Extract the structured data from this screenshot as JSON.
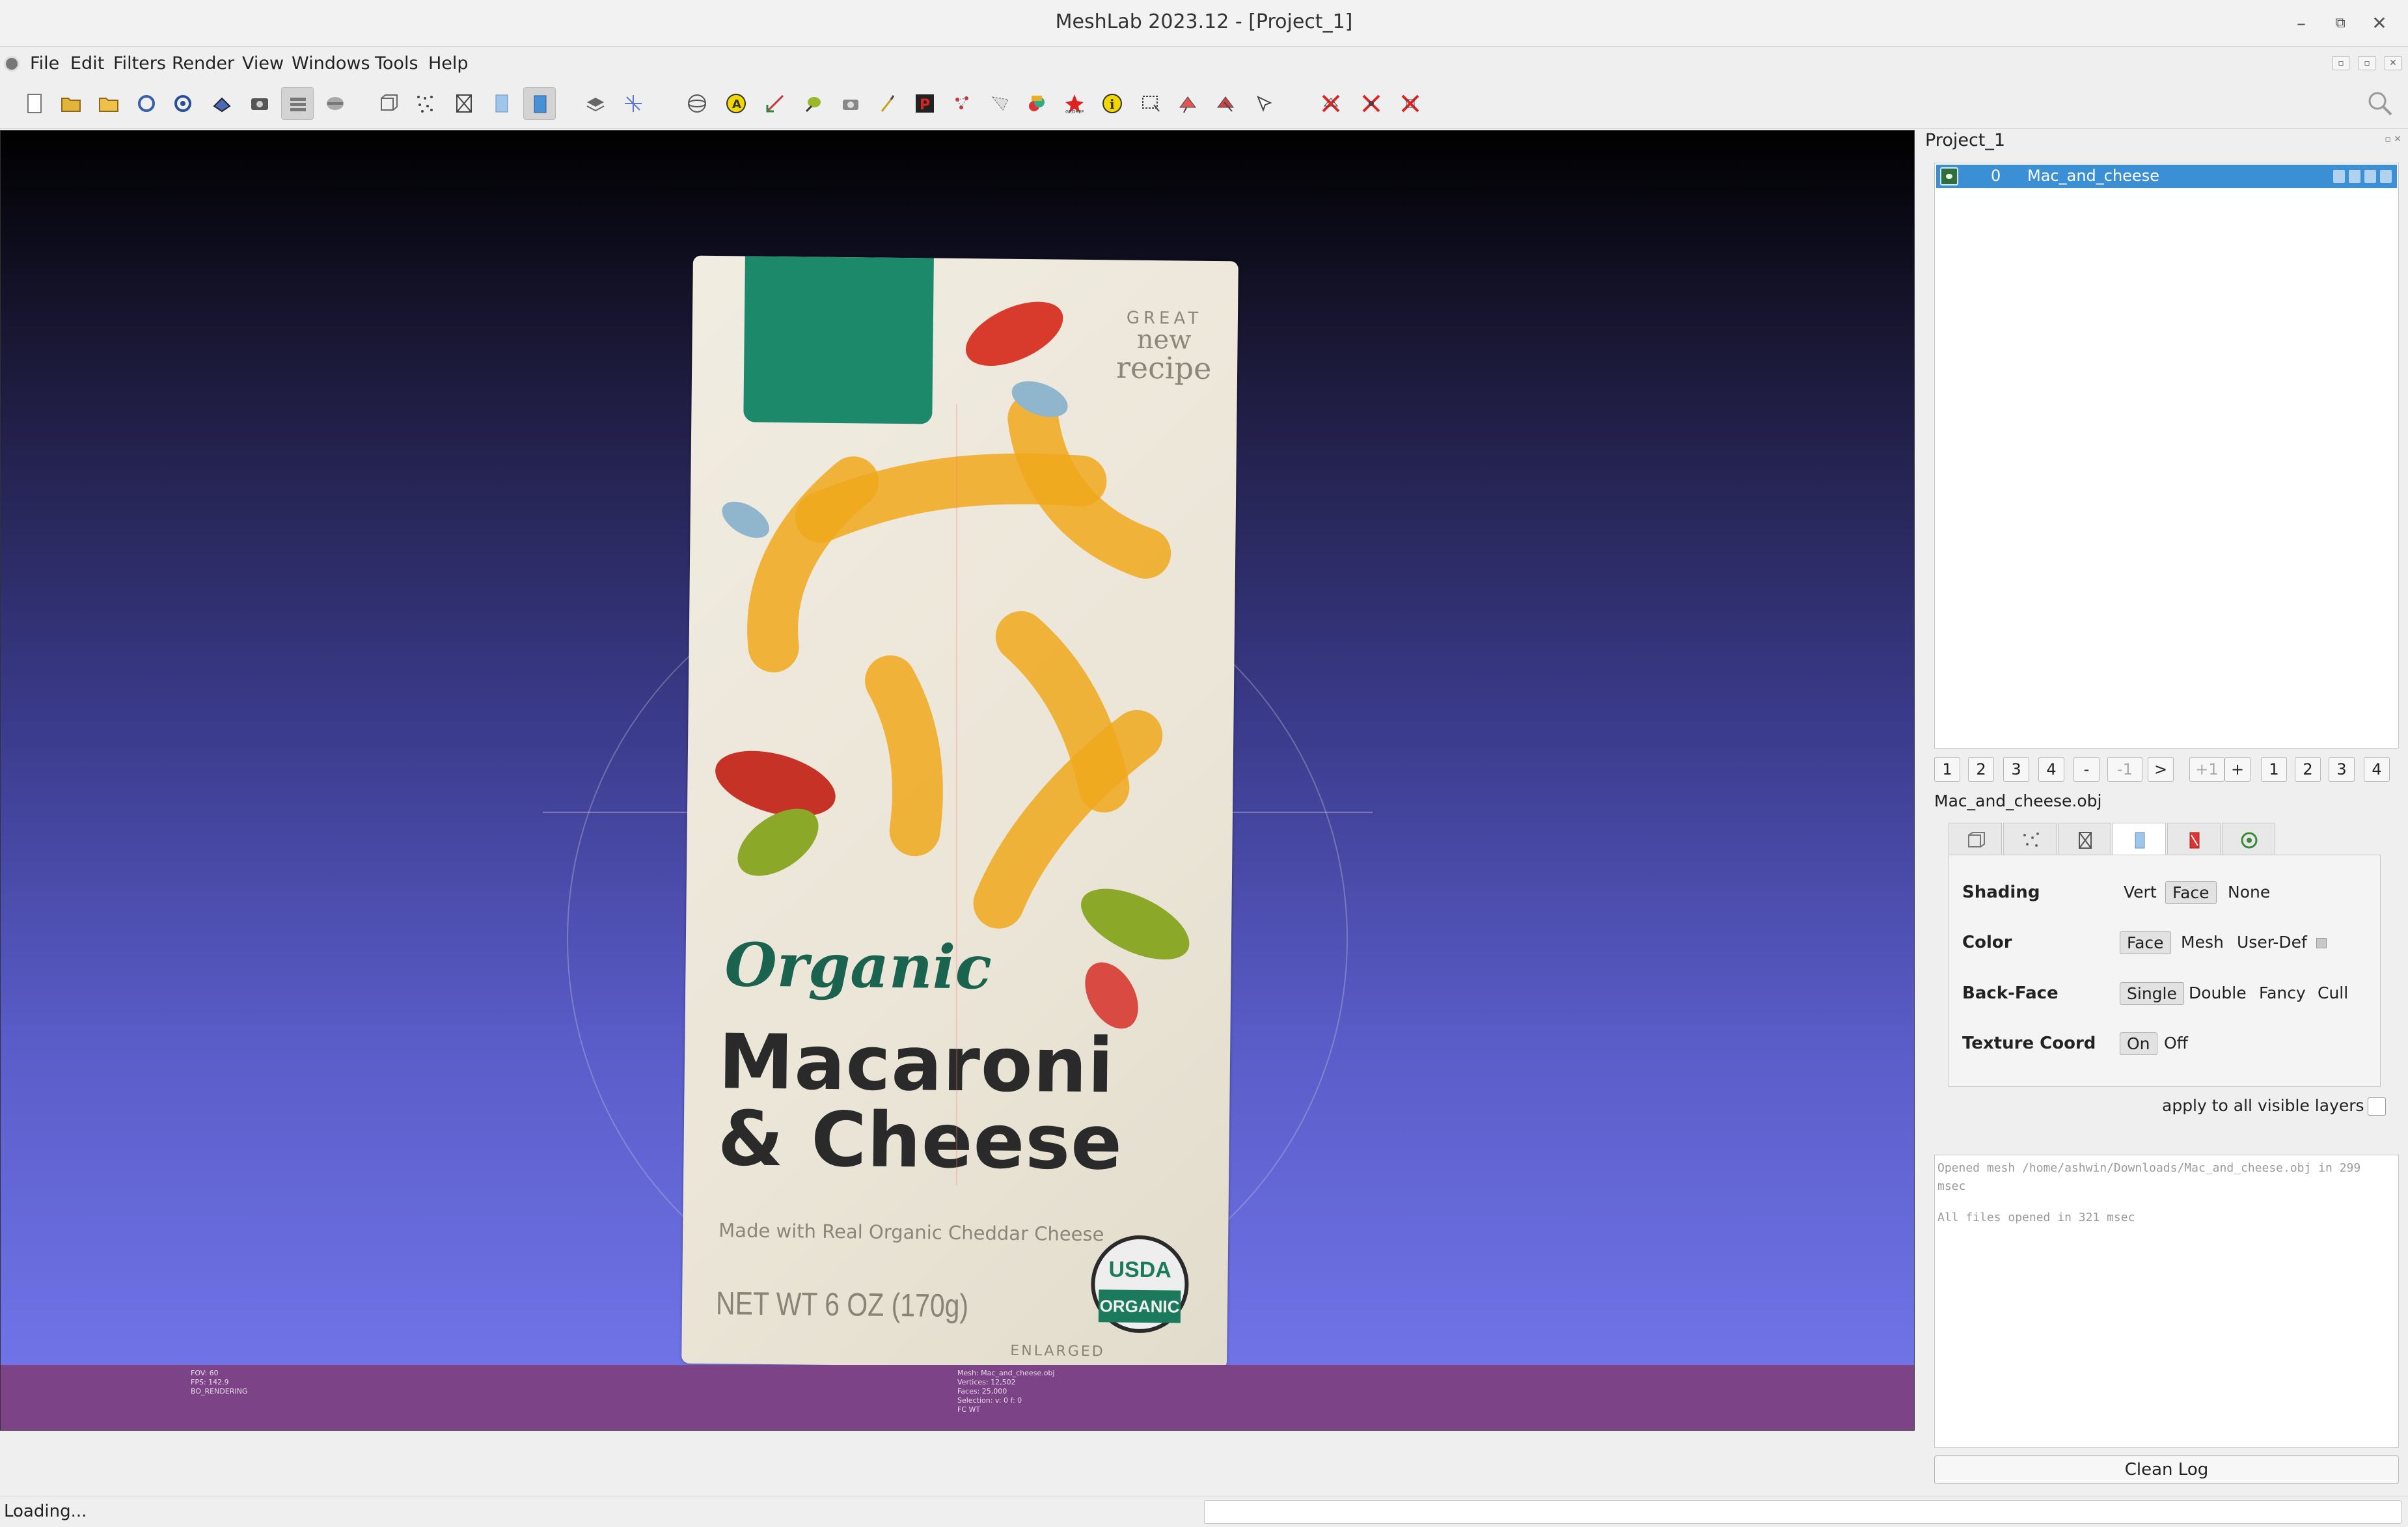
{
  "window": {
    "title": "MeshLab 2023.12 - [Project_1]",
    "minimize_glyph": "–",
    "restore_glyph": "⧉",
    "close_glyph": "✕"
  },
  "menu": {
    "items": [
      "File",
      "Edit",
      "Filters",
      "Render",
      "View",
      "Windows",
      "Tools",
      "Help"
    ]
  },
  "mdi_controls": [
    "▫",
    "▫",
    "✕"
  ],
  "toolbar": {
    "icons": [
      "new-project-icon",
      "open-project-icon",
      "import-mesh-icon",
      "reload-icon",
      "reload-all-icon",
      "export-mesh-icon",
      "snapshot-icon",
      "layers-icon",
      "raster-layers-icon",
      "bounding-box-icon",
      "points-icon",
      "wireframe-icon",
      "flat-icon",
      "smooth-icon",
      "light-icon",
      "axis-icon",
      "trackball-icon",
      "annotate-icon",
      "measure-icon",
      "pick-icon",
      "camera-icon",
      "paint-brush-icon",
      "pick-points-icon",
      "select-vertices-icon",
      "select-faces-icon",
      "align-icon",
      "georef-icon",
      "info-icon",
      "select-rect-icon",
      "select-connected-icon",
      "select-conn-faces-icon",
      "select-vertex-icon",
      "delete-face-icon",
      "delete-vertex-icon",
      "delete-selected-icon"
    ],
    "active": [
      "layers-icon",
      "smooth-icon"
    ]
  },
  "viewport": {
    "model": {
      "badge": "GREAT",
      "badge_line2": "new",
      "badge_line3": "recipe",
      "brand_script": "Organic",
      "product_line1": "Macaroni",
      "product_line2": "& Cheese",
      "subtitle": "Made with Real Organic Cheddar Cheese",
      "net_weight": "NET WT 6 OZ (170g)",
      "seal_top": "USDA",
      "seal_bottom": "ORGANIC",
      "footnote": "ENLARGED"
    },
    "info_left": [
      "FOV: 60",
      "FPS:   142.9",
      "BO_RENDERING"
    ],
    "info_mid": [
      "Mesh: Mac_and_cheese.obj",
      "Vertices: 12,502",
      "Faces: 25,000",
      "Selection: v: 0 f: 0",
      "FC WT"
    ]
  },
  "panel": {
    "title": "Project_1",
    "float_glyph": "▫ ✕",
    "layers": [
      {
        "index": "0",
        "name": "Mac_and_cheese"
      }
    ],
    "nav_buttons": [
      "1",
      "2",
      "3",
      "4",
      "-",
      "-1",
      ">",
      "+1",
      "+",
      "1",
      "2",
      "3",
      "4"
    ],
    "nav_disabled": [
      "-1",
      "+1"
    ],
    "mesh_file": "Mac_and_cheese.obj",
    "render_tabs": [
      "box-tab-icon",
      "points-tab-icon",
      "wire-tab-icon",
      "solid-tab-icon",
      "texture-tab-icon",
      "extra-tab-icon"
    ],
    "render_tab_active": "solid-tab-icon",
    "options": {
      "shading": {
        "label": "Shading",
        "values": [
          "Vert",
          "Face",
          "None"
        ],
        "selected": "Face"
      },
      "color": {
        "label": "Color",
        "values": [
          "Face",
          "Mesh",
          "User-Def"
        ],
        "selected": "Face"
      },
      "backface": {
        "label": "Back-Face",
        "values": [
          "Single",
          "Double",
          "Fancy",
          "Cull"
        ],
        "selected": "Single"
      },
      "texcoord": {
        "label": "Texture Coord",
        "values": [
          "On",
          "Off"
        ],
        "selected": "On"
      }
    },
    "apply_all": "apply to all visible layers",
    "log": [
      "Opened mesh /home/ashwin/Downloads/Mac_and_cheese.obj in 299 msec",
      "All files opened in 321 msec"
    ],
    "clean_log": "Clean Log"
  },
  "status": {
    "text": "Loading..."
  }
}
